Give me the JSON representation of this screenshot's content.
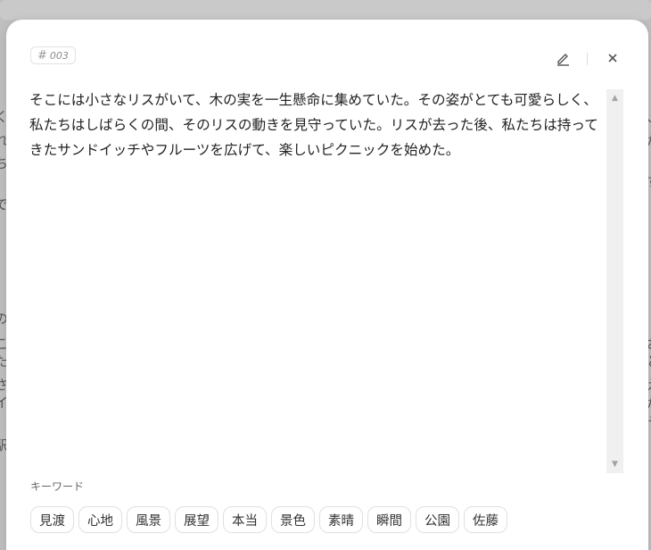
{
  "background": {
    "glyphs_left": [
      "く",
      "れ",
      "ち",
      "、",
      "で",
      "の",
      "こ",
      "た",
      "さ",
      "イ",
      "駅"
    ],
    "glyphs_right": [
      "、",
      "が",
      "ず",
      "お",
      "と",
      "え",
      "が",
      "う"
    ]
  },
  "modal": {
    "id_hash": "#",
    "id_value": "003",
    "edit_icon": "pencil-icon",
    "close_icon": "close-icon",
    "body_text": "そこには小さなリスがいて、木の実を一生懸命に集めていた。その姿がとても可愛らしく、私たちはしばらくの間、そのリスの動きを見守っていた。リスが去った後、私たちは持ってきたサンドイッチやフルーツを広げて、楽しいピクニックを始めた。",
    "keywords_label": "キーワード",
    "keywords": [
      "見渡",
      "心地",
      "風景",
      "展望",
      "本当",
      "景色",
      "素晴",
      "瞬間",
      "公園",
      "佐藤"
    ]
  }
}
